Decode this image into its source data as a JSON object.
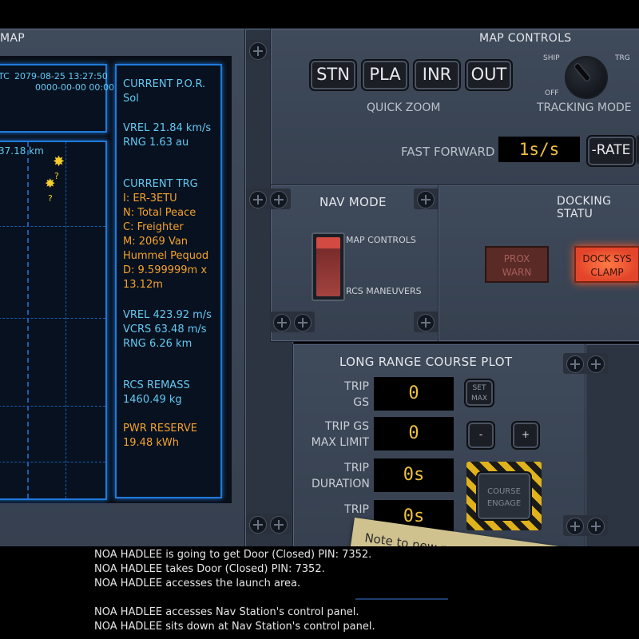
{
  "map": {
    "header_partial": "MAP",
    "clock_tag": "TC",
    "datetime": "2079-08-25 13:27:50",
    "datetime_zero": "0000-00-00 00:00:00",
    "distance": "37.18 km",
    "marker_label": "?",
    "info": {
      "por_title": "CURRENT P.O.R.",
      "por_value": "Sol",
      "vrel1": "VREL 21.84 km/s",
      "rng1": "RNG 1.63 au",
      "trg_title": "CURRENT TRG",
      "trg_lines": [
        "I: ER-3ETU",
        "N: Total Peace",
        "C: Freighter",
        "M: 2069 Van",
        "Hummel Pequod",
        "D: 9.599999m x",
        "13.12m"
      ],
      "vrel2": "VREL 423.92 m/s",
      "vcrs2": "VCRS 63.48 m/s",
      "rng2": "RNG 6.26 km",
      "remass_title": "RCS REMASS",
      "remass_value": "1460.49 kg",
      "pwr_title": "PWR RESERVE",
      "pwr_value": "19.48 kWh"
    }
  },
  "map_controls": {
    "title": "MAP CONTROLS",
    "zoom_buttons": [
      "STN",
      "PLA",
      "INR",
      "OUT"
    ],
    "quick_zoom": "QUICK ZOOM",
    "tracking_mode": "TRACKING MODE",
    "knob_ship": "SHIP",
    "knob_trg": "TRG",
    "knob_off": "OFF",
    "fast_forward": "FAST FORWARD",
    "ff_value": "1s/s",
    "rate_button": "-RATE"
  },
  "nav_mode": {
    "title": "NAV MODE",
    "opt_top": "MAP CONTROLS",
    "opt_bottom": "RCS MANEUVERS"
  },
  "docking": {
    "title": "DOCKING STATU",
    "prox_warn": "PROX WARN",
    "dock_clamp": "DOCK SYS CLAMP"
  },
  "course_plot": {
    "title": "LONG RANGE COURSE PLOT",
    "trip_gs_label": "TRIP GS",
    "trip_gs_value": "0",
    "set_max": "SET MAX",
    "max_limit_label": "TRIP GS MAX LIMIT",
    "max_limit_value": "0",
    "minus": "-",
    "plus": "+",
    "duration_label": "TRIP DURATION",
    "duration_value": "0s",
    "fuel_label": "TRIP FU",
    "fuel_value": "0s",
    "engage": "COURSE ENGAGE"
  },
  "note": {
    "text": "Note to new per"
  },
  "log": {
    "lines": [
      "NOA HADLEE is going to get Door (Closed) PIN: 7352.",
      "NOA HADLEE takes Door (Closed) PIN: 7352.",
      "NOA HADLEE accesses the launch area.",
      "",
      "NOA HADLEE accesses Nav Station's control panel.",
      "NOA HADLEE sits down at Nav Station's control panel."
    ]
  },
  "colors": {
    "cyan": "#62c9f2",
    "orange": "#f5a22c",
    "lcd_yellow": "#f0c138",
    "grid_blue": "#1f7bd9"
  }
}
